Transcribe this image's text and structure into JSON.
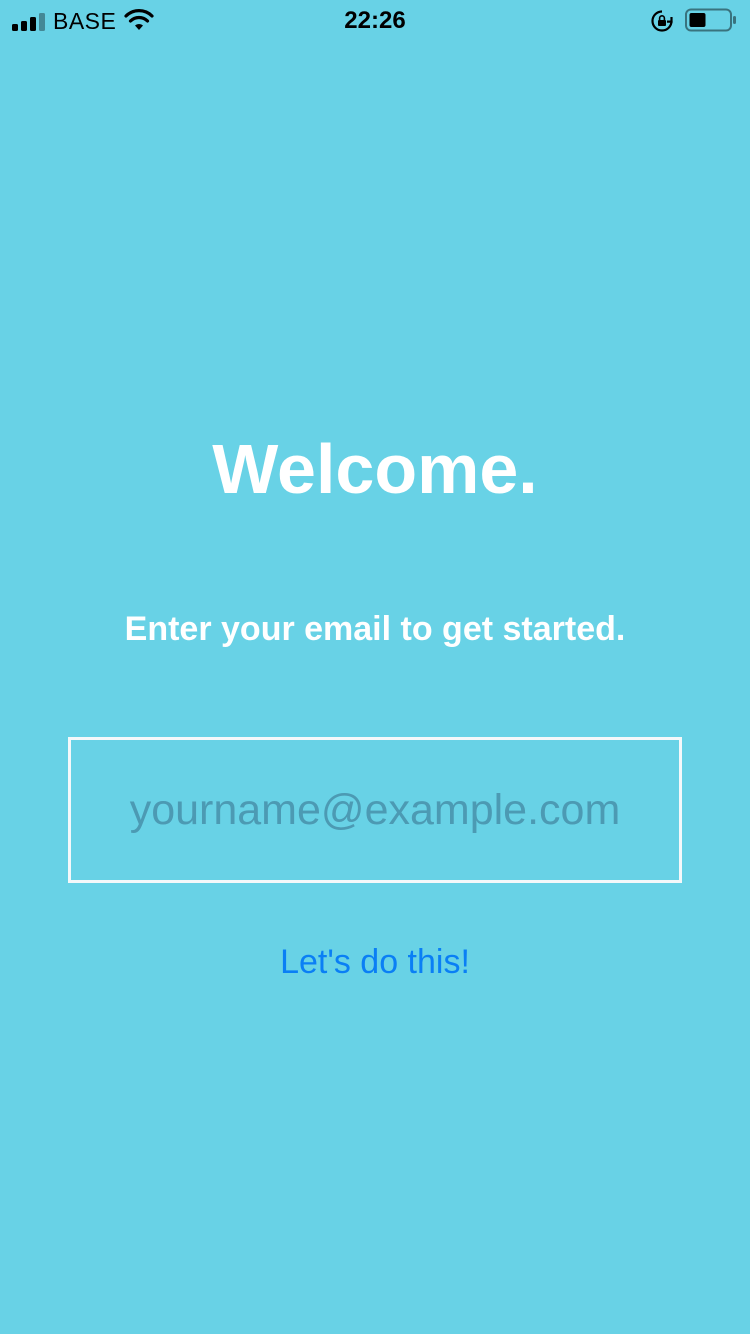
{
  "status_bar": {
    "carrier": "BASE",
    "time": "22:26",
    "icons": [
      "signal-icon",
      "wifi-icon",
      "rotation-lock-icon",
      "battery-icon"
    ]
  },
  "welcome": {
    "title": "Welcome.",
    "subtitle": "Enter your email to get started.",
    "email_placeholder": "yourname@example.com",
    "email_value": "",
    "cta_label": "Let's do this!"
  },
  "colors": {
    "background": "#68d2e6",
    "text": "#ffffff",
    "cta": "#0a7ff5",
    "placeholder": "#4c9ab3",
    "field_border": "#f4f8fa"
  }
}
